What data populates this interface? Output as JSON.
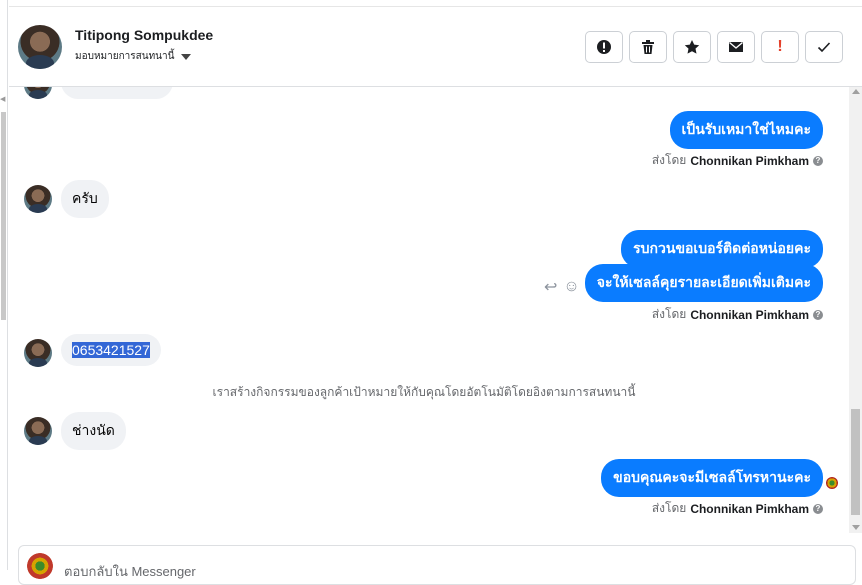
{
  "header": {
    "contact_name": "Titipong Sompukdee",
    "assign_label": "มอบหมายการสนทนานี้",
    "actions": [
      {
        "name": "report-spam-button",
        "icon": "alert-circle-icon"
      },
      {
        "name": "delete-button",
        "icon": "trash-icon"
      },
      {
        "name": "star-button",
        "icon": "star-icon"
      },
      {
        "name": "mark-unread-button",
        "icon": "envelope-icon"
      },
      {
        "name": "flag-button",
        "icon": "exclamation-icon",
        "label": "!"
      },
      {
        "name": "done-button",
        "icon": "check-icon"
      }
    ]
  },
  "thread": {
    "out_msg_1": "เป็นรับเหมาใช่ไหมคะ",
    "sent_prefix": "ส่งโดย",
    "sender": "Chonnikan Pimkham",
    "help_glyph": "?",
    "in_msg_1": "ครับ",
    "out_msg_2": "รบกวนขอเบอร์ติดต่อหน่อยคะ",
    "out_msg_3": "จะให้เซลล์คุยรายละเอียดเพิ่มเติมคะ",
    "in_msg_2": "0653421527",
    "system_note": "เราสร้างกิจกรรมของลูกค้าเป้าหมายให้กับคุณโดยอัตโนมัติโดยอิงตามการสนทนานี้",
    "in_msg_3": "ช่างนัด",
    "out_msg_4": "ขอบคุณคะจะมีเซลล์โทรหานะคะ"
  },
  "composer": {
    "placeholder": "ตอบกลับใน Messenger"
  },
  "colors": {
    "outgoing": "#0a7cff",
    "incoming": "#f0f2f5",
    "selection": "#3367d6"
  }
}
